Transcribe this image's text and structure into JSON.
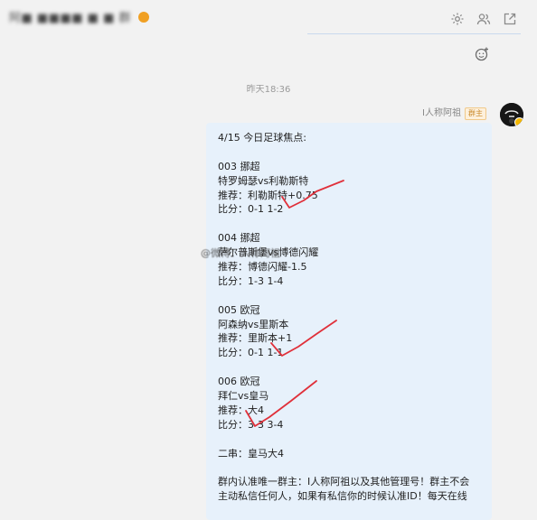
{
  "header": {
    "title": "阿■ ■■■■ ■ ■ 群",
    "icons": [
      "settings-icon",
      "group-members-icon",
      "open-external-icon"
    ]
  },
  "chat": {
    "timestamp": "昨天18:36",
    "sender_name": "I人称阿祖",
    "sender_badge": "群主",
    "message_lines": [
      "4/15 今日足球焦点:",
      "",
      "003 挪超",
      "特罗姆瑟vs利勒斯特",
      "推荐：利勒斯特+0.75",
      "比分：0-1 1-2",
      "",
      "004 挪超",
      "萨尔普斯堡vs博德闪耀",
      "推荐：博德闪耀-1.5",
      "比分：1-3 1-4",
      "",
      "005 欧冠",
      "阿森纳vs里斯本",
      "推荐：里斯本+1",
      "比分：0-1 1-1",
      "",
      "006 欧冠",
      "拜仁vs皇马",
      "推荐：大4",
      "比分：3-3 3-4",
      "",
      "二串：皇马大4",
      "",
      "群内认准唯一群主：I人称阿祖以及其他管理号！群主不会",
      "主动私信任何人，如果有私信你的时候认准ID！每天在线"
    ],
    "watermark": "@微博：人称阿祖"
  },
  "colors": {
    "background": "#f2f2f2",
    "bubble": "#e7f1fb",
    "tick_marks": "#e0303a",
    "badge": "#c9892a"
  }
}
